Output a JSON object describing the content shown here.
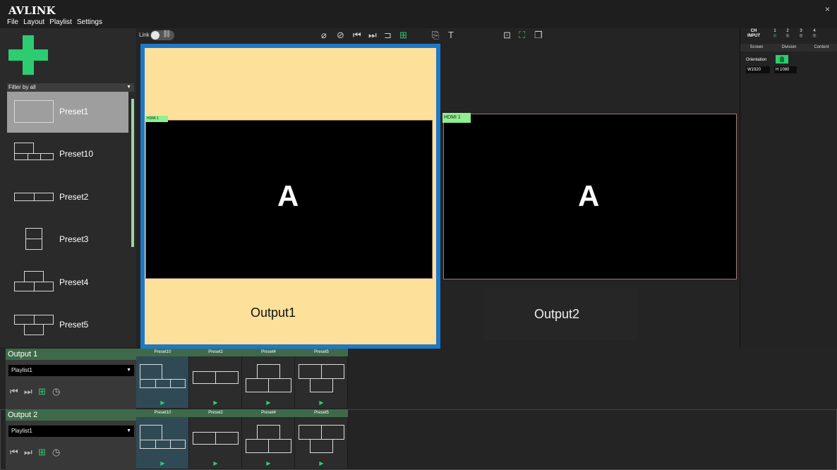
{
  "app": {
    "logo": "AVLINK",
    "menu": [
      "File",
      "Layout",
      "Playlist",
      "Settings"
    ],
    "close": "×"
  },
  "left_panel": {
    "filter": "Filter by all",
    "presets": [
      {
        "label": "Preset1",
        "selected": true
      },
      {
        "label": "Preset10",
        "selected": false
      },
      {
        "label": "Preset2",
        "selected": false
      },
      {
        "label": "Preset3",
        "selected": false
      },
      {
        "label": "Preset4",
        "selected": false
      },
      {
        "label": "Preset5",
        "selected": false
      }
    ]
  },
  "toolbar": {
    "link_label": "Link",
    "link_enabled": false,
    "icons": [
      "hide-icon",
      "hide-all-icon",
      "prev-icon",
      "next-icon",
      "stretch-icon",
      "grid-icon",
      "export-icon",
      "text-icon",
      "align-icon",
      "lock-icon",
      "layer-icon"
    ]
  },
  "canvas": {
    "output1": {
      "label": "Output1",
      "content": "A",
      "tag": "HDMI 1"
    },
    "output2": {
      "label": "Output2",
      "content": "A",
      "tag": "HDMI 1"
    }
  },
  "right_panel": {
    "ch_label": "CH",
    "input_label": "INPUT",
    "channels": [
      "1",
      "2",
      "3",
      "4"
    ],
    "tabs": [
      "Screen",
      "Division",
      "Content"
    ],
    "orientation_label": "Orientation",
    "width": "W1920",
    "height": "H 1080"
  },
  "outputs": [
    {
      "name": "Output 1",
      "playlist": "Playlist1",
      "items": [
        "Preset10",
        "Preset2",
        "Preset4",
        "Preset5"
      ],
      "active_index": 0
    },
    {
      "name": "Output 2",
      "playlist": "Playlist1",
      "items": [
        "Preset10",
        "Preset2",
        "Preset4",
        "Preset5"
      ],
      "active_index": 0
    }
  ],
  "colors": {
    "accent_green": "#2ecc71",
    "output1_border": "#1e78c8",
    "output1_fill": "#fde19a"
  }
}
